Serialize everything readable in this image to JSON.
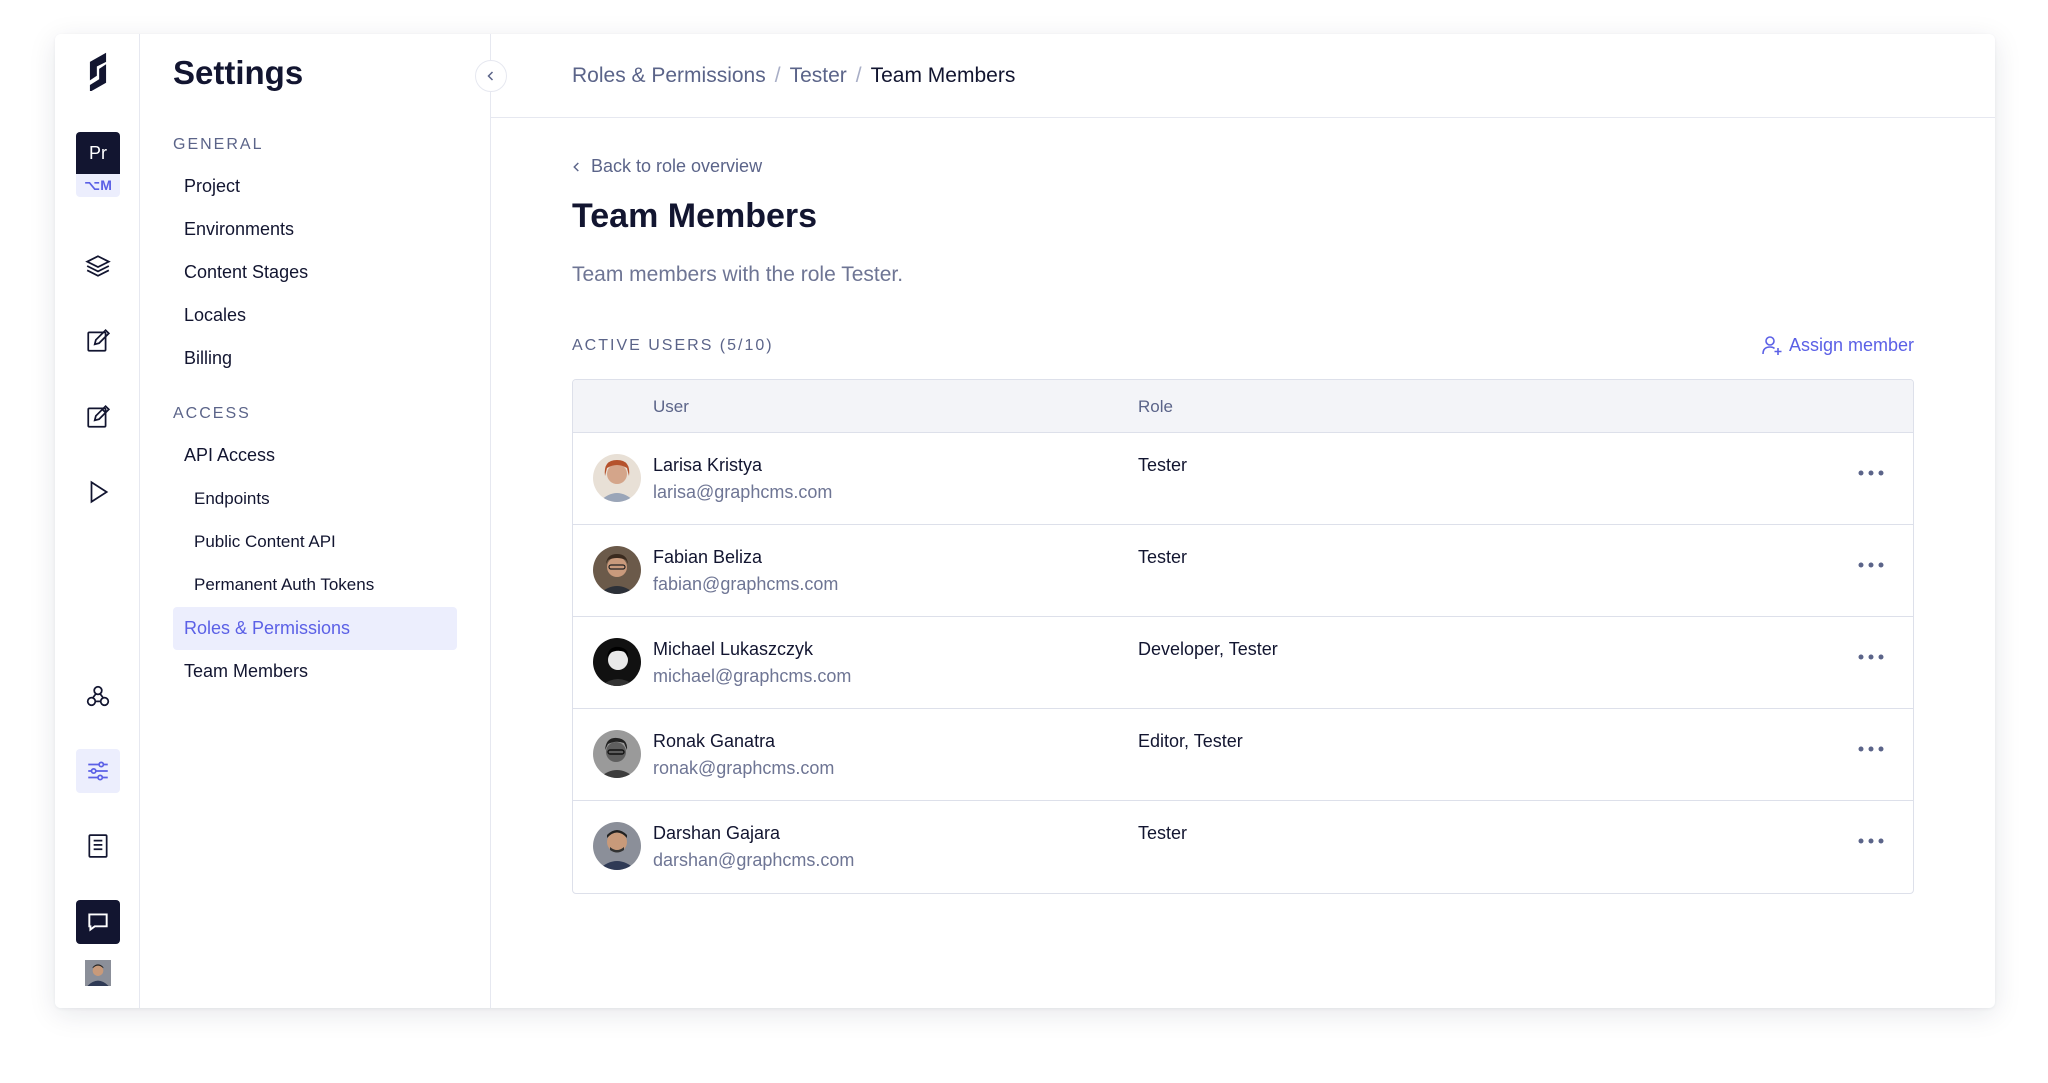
{
  "rail": {
    "project_initials": "Pr",
    "env_label": "⌥M"
  },
  "sidebar": {
    "title": "Settings",
    "general_label": "GENERAL",
    "general_items": [
      {
        "label": "Project"
      },
      {
        "label": "Environments"
      },
      {
        "label": "Content Stages"
      },
      {
        "label": "Locales"
      },
      {
        "label": "Billing"
      }
    ],
    "access_label": "ACCESS",
    "access_items": [
      {
        "label": "API Access"
      },
      {
        "label": "Endpoints"
      },
      {
        "label": "Public Content API"
      },
      {
        "label": "Permanent Auth Tokens"
      },
      {
        "label": "Roles & Permissions"
      },
      {
        "label": "Team Members"
      }
    ]
  },
  "breadcrumb": {
    "items": [
      "Roles & Permissions",
      "Tester",
      "Team Members"
    ],
    "separator": "/"
  },
  "main": {
    "back_label": "Back to role overview",
    "title": "Team Members",
    "description": "Team members with the role Tester.",
    "active_users_label": "ACTIVE USERS (5/10)",
    "assign_label": "Assign member",
    "columns": {
      "user": "User",
      "role": "Role"
    },
    "rows": [
      {
        "name": "Larisa Kristya",
        "email": "larisa@graphcms.com",
        "role": "Tester"
      },
      {
        "name": "Fabian Beliza",
        "email": "fabian@graphcms.com",
        "role": "Tester"
      },
      {
        "name": "Michael Lukaszczyk",
        "email": "michael@graphcms.com",
        "role": "Developer, Tester"
      },
      {
        "name": "Ronak Ganatra",
        "email": "ronak@graphcms.com",
        "role": "Editor, Tester"
      },
      {
        "name": "Darshan Gajara",
        "email": "darshan@graphcms.com",
        "role": "Tester"
      }
    ]
  },
  "colors": {
    "accent": "#5b60e6",
    "dark": "#121530",
    "muted": "#5b6489",
    "selected_bg": "#eceefd"
  }
}
